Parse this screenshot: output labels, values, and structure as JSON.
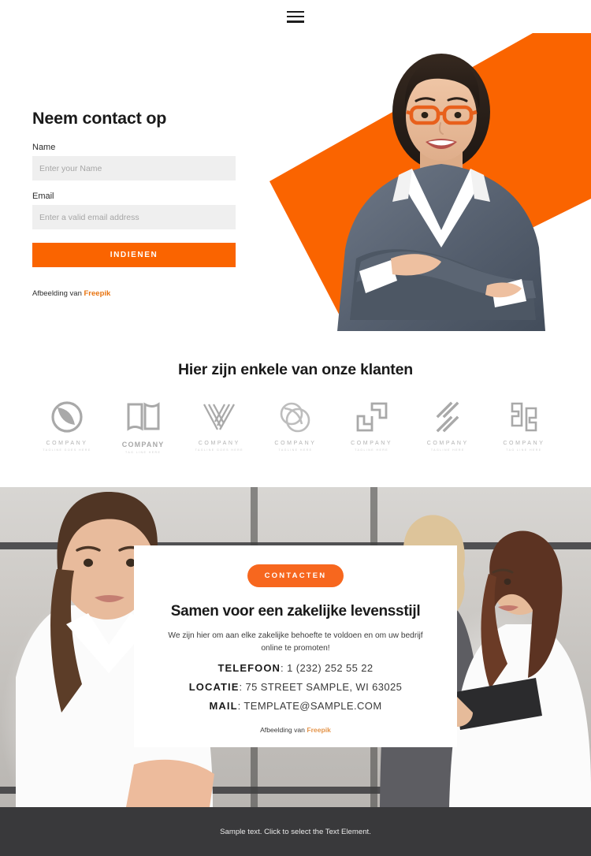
{
  "header": {
    "menu_icon": "hamburger-menu-icon"
  },
  "hero": {
    "form_title": "Neem contact op",
    "fields": [
      {
        "label": "Name",
        "placeholder": "Enter your Name",
        "value": ""
      },
      {
        "label": "Email",
        "placeholder": "Enter a valid email address",
        "value": ""
      }
    ],
    "submit_label": "INDIENEN",
    "credit_prefix": "Afbeelding van ",
    "credit_link": "Freepik",
    "accent_color": "#fa6400",
    "image_alt": "smiling-businesswoman-with-orange-glasses"
  },
  "clients": {
    "title": "Hier zijn enkele van onze klanten",
    "logos": [
      {
        "mark": "overlapping-leaf-circle-icon",
        "name": "COMPANY",
        "tagline": "TAGLINE GOES HERE"
      },
      {
        "mark": "open-book-pages-icon",
        "name": "COMPANY",
        "tagline": "TAG LINE HERE"
      },
      {
        "mark": "striped-v-chevron-icon",
        "name": "COMPANY",
        "tagline": "TAGLINE GOES HERE"
      },
      {
        "mark": "double-circle-loop-icon",
        "name": "COMPANY",
        "tagline": "TAGLINE HERE"
      },
      {
        "mark": "two-squares-brackets-icon",
        "name": "COMPANY",
        "tagline": "TAGLINE HERE"
      },
      {
        "mark": "diagonal-stripes-icon",
        "name": "COMPANY",
        "tagline": "TAGLINE HERE"
      },
      {
        "mark": "mirrored-letterform-icon",
        "name": "COMPANY",
        "tagline": "TAG LINE HERE"
      }
    ]
  },
  "contact_section": {
    "badge": "CONTACTEN",
    "title": "Samen voor een zakelijke levensstijl",
    "subtitle": "We zijn hier om aan elke zakelijke behoefte te voldoen en om uw bedrijf online te promoten!",
    "details": [
      {
        "label": "TELEFOON",
        "value": "1 (232) 252 55 22"
      },
      {
        "label": "LOCATIE",
        "value": "75 STREET SAMPLE, WI 63025"
      },
      {
        "label": "MAIL",
        "value": "TEMPLATE@SAMPLE.COM"
      }
    ],
    "credit_prefix": "Afbeelding van ",
    "credit_link": "Freepik",
    "badge_color": "#f7671e",
    "background_alt": "women-in-office-meeting-photo"
  },
  "footer": {
    "text": "Sample text. Click to select the Text Element.",
    "background_color": "#39393b"
  }
}
